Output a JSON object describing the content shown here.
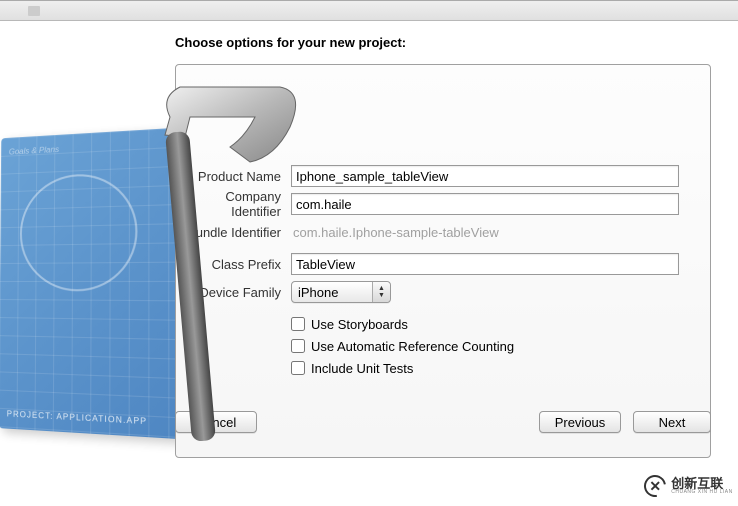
{
  "topbar": {
    "text": ""
  },
  "heading": "Choose options for your new project:",
  "form": {
    "productName": {
      "label": "Product Name",
      "value": "Iphone_sample_tableView"
    },
    "companyIdentifier": {
      "label": "Company Identifier",
      "value": "com.haile"
    },
    "bundleIdentifier": {
      "label": "Bundle Identifier",
      "value": "com.haile.Iphone-sample-tableView"
    },
    "classPrefix": {
      "label": "Class Prefix",
      "value": "TableView"
    },
    "deviceFamily": {
      "label": "Device Family",
      "value": "iPhone"
    },
    "useStoryboards": {
      "label": "Use Storyboards"
    },
    "useArc": {
      "label": "Use Automatic Reference Counting"
    },
    "includeUnitTests": {
      "label": "Include Unit Tests"
    }
  },
  "buttons": {
    "cancel": "Cancel",
    "previous": "Previous",
    "next": "Next"
  },
  "artwork": {
    "blueprintBottom": "PROJECT: APPLICATION.APP",
    "blueprintTop": "Goals & Plans"
  },
  "watermark": {
    "cn": "创新互联",
    "en": "CHUANG XIN HU LIAN"
  }
}
